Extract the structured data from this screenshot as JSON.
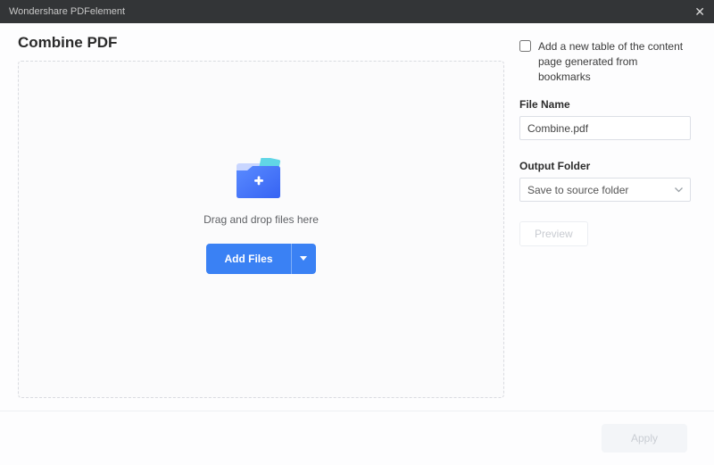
{
  "titlebar": {
    "app_name": "Wondershare PDFelement"
  },
  "header": {
    "title": "Combine PDF"
  },
  "dropzone": {
    "hint": "Drag and drop files here",
    "add_label": "Add Files"
  },
  "options": {
    "checkbox_label": "Add a new table of the content page generated from bookmarks",
    "filename_label": "File Name",
    "filename_value": "Combine.pdf",
    "output_folder_label": "Output Folder",
    "output_folder_value": "Save to source folder",
    "preview_label": "Preview"
  },
  "footer": {
    "apply_label": "Apply"
  }
}
